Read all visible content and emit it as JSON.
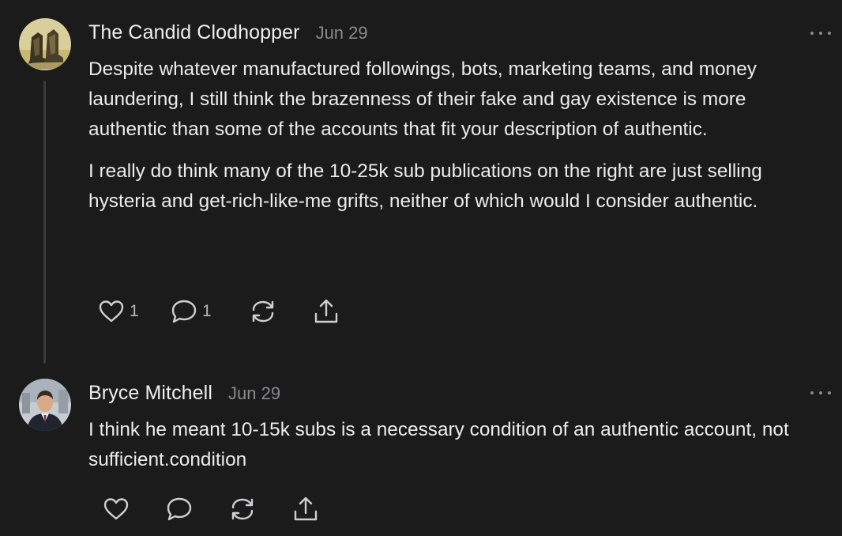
{
  "comments": [
    {
      "author": "The Candid Clodhopper",
      "date": "Jun 29",
      "paragraphs": [
        "Despite whatever manufactured followings, bots, marketing teams, and money laundering, I still think the brazenness of their fake and gay existence is more authentic than some of the accounts that fit your description of authentic.",
        "I really do think many of the 10-25k sub publications on the right are just selling hysteria and get-rich-like-me grifts, neither of which would I consider authentic."
      ],
      "likes": "1",
      "replies": "1",
      "avatar": "avatar-boots-image"
    },
    {
      "author": "Bryce Mitchell",
      "date": "Jun 29",
      "paragraphs": [
        "I think he meant 10-15k subs is a necessary condition of an authentic account, not sufficient.condition"
      ],
      "avatar": "avatar-person-photo"
    }
  ],
  "icons": {
    "like": "heart-icon",
    "reply": "speech-bubble-icon",
    "restack": "restack-icon",
    "share": "share-icon",
    "more": "more-icon"
  },
  "colors": {
    "background": "#1b1b1c",
    "text": "#ececec",
    "muted": "#8a8a8e",
    "thread_line": "#3a3a3c"
  }
}
